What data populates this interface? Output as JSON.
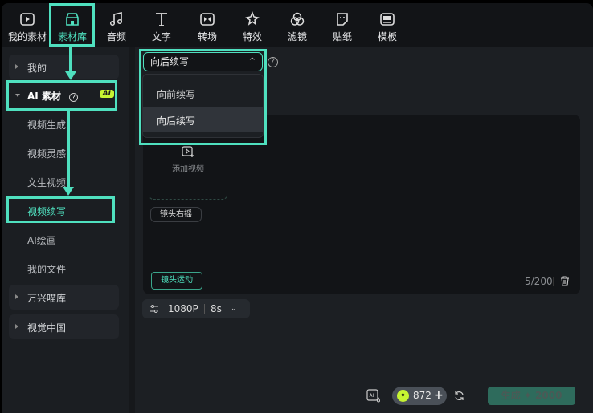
{
  "tabs": [
    {
      "label": "我的素材",
      "icon": "my-media-icon"
    },
    {
      "label": "素材库",
      "icon": "store-icon",
      "active": true
    },
    {
      "label": "音频",
      "icon": "music-icon"
    },
    {
      "label": "文字",
      "icon": "text-icon"
    },
    {
      "label": "转场",
      "icon": "transition-icon"
    },
    {
      "label": "特效",
      "icon": "effects-icon"
    },
    {
      "label": "滤镜",
      "icon": "filter-icon"
    },
    {
      "label": "贴纸",
      "icon": "sticker-icon"
    },
    {
      "label": "模板",
      "icon": "template-icon"
    }
  ],
  "sidebar": {
    "mine": "我的",
    "ai_group": "AI 素材",
    "ai_badge": "AI",
    "items": [
      "视频生成",
      "视频灵感",
      "文生视频",
      "视频续写",
      "AI绘画",
      "我的文件"
    ],
    "active_item": "视频续写",
    "wanxing": "万兴喵库",
    "visual_china": "视觉中国"
  },
  "main": {
    "mode_select": "向后续写",
    "mode_options": [
      "向前续写",
      "向后续写"
    ],
    "add_video": "添加视频",
    "camera_tag": "镜头右摇",
    "camera_motion": "镜头运动",
    "char_count": "5/200",
    "resolution": "1080P",
    "duration": "8s",
    "credits": "872",
    "generate_label": "生成",
    "generate_cost": "2000"
  },
  "colors": {
    "accent": "#4fe0bf",
    "ai_badge": "#c6f432"
  }
}
